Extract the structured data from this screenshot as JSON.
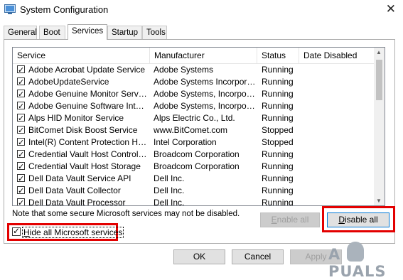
{
  "window": {
    "title": "System Configuration",
    "close_glyph": "✕"
  },
  "tabs": [
    {
      "label": "General",
      "active": false
    },
    {
      "label": "Boot",
      "active": false
    },
    {
      "label": "Services",
      "active": true
    },
    {
      "label": "Startup",
      "active": false
    },
    {
      "label": "Tools",
      "active": false
    }
  ],
  "services_table": {
    "headers": [
      "Service",
      "Manufacturer",
      "Status",
      "Date Disabled"
    ],
    "rows": [
      {
        "service": "Adobe Acrobat Update Service",
        "manufacturer": "Adobe Systems",
        "status": "Running",
        "checked": true
      },
      {
        "service": "AdobeUpdateService",
        "manufacturer": "Adobe Systems Incorporated",
        "status": "Running",
        "checked": true
      },
      {
        "service": "Adobe Genuine Monitor Service",
        "manufacturer": "Adobe Systems, Incorpora...",
        "status": "Running",
        "checked": true
      },
      {
        "service": "Adobe Genuine Software Integri...",
        "manufacturer": "Adobe Systems, Incorpora...",
        "status": "Running",
        "checked": true
      },
      {
        "service": "Alps HID Monitor Service",
        "manufacturer": "Alps Electric Co., Ltd.",
        "status": "Running",
        "checked": true
      },
      {
        "service": "BitComet Disk Boost Service",
        "manufacturer": "www.BitComet.com",
        "status": "Stopped",
        "checked": true
      },
      {
        "service": "Intel(R) Content Protection HEC...",
        "manufacturer": "Intel Corporation",
        "status": "Stopped",
        "checked": true
      },
      {
        "service": "Credential Vault Host Control Se...",
        "manufacturer": "Broadcom Corporation",
        "status": "Running",
        "checked": true
      },
      {
        "service": "Credential Vault Host Storage",
        "manufacturer": "Broadcom Corporation",
        "status": "Running",
        "checked": true
      },
      {
        "service": "Dell Data Vault Service API",
        "manufacturer": "Dell Inc.",
        "status": "Running",
        "checked": true
      },
      {
        "service": "Dell Data Vault Collector",
        "manufacturer": "Dell Inc.",
        "status": "Running",
        "checked": true
      },
      {
        "service": "Dell Data Vault Processor",
        "manufacturer": "Dell Inc.",
        "status": "Running",
        "checked": true
      }
    ]
  },
  "note": "Note that some secure Microsoft services may not be disabled.",
  "buttons": {
    "enable_all": {
      "prefix": "",
      "accel": "E",
      "rest": "nable all",
      "enabled": false
    },
    "disable_all": {
      "prefix": "",
      "accel": "D",
      "rest": "isable all",
      "enabled": true
    },
    "ok": "OK",
    "cancel": "Cancel",
    "apply": "Apply"
  },
  "hide_ms": {
    "prefix": "",
    "accel": "H",
    "rest": "ide all Microsoft services",
    "checked": true
  },
  "watermark": "A  PUALS",
  "colors": {
    "highlight": "#e30000",
    "focus": "#0078d7"
  },
  "icons": {
    "app": "system-configuration-icon",
    "close": "close-icon"
  }
}
